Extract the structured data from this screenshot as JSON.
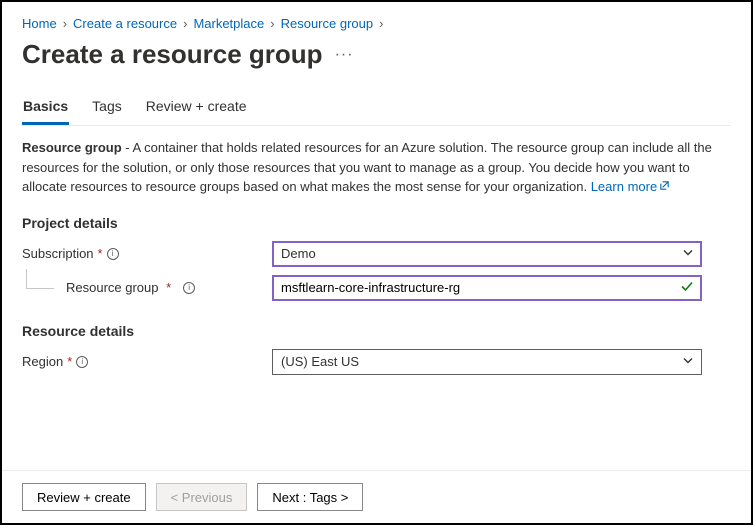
{
  "breadcrumb": {
    "items": [
      "Home",
      "Create a resource",
      "Marketplace",
      "Resource group"
    ]
  },
  "page_title": "Create a resource group",
  "tabs": {
    "items": [
      {
        "label": "Basics",
        "active": true
      },
      {
        "label": "Tags",
        "active": false
      },
      {
        "label": "Review + create",
        "active": false
      }
    ]
  },
  "description": {
    "bold_lead": "Resource group",
    "text": " - A container that holds related resources for an Azure solution. The resource group can include all the resources for the solution, or only those resources that you want to manage as a group. You decide how you want to allocate resources to resource groups based on what makes the most sense for your organization. ",
    "learn_more": "Learn more"
  },
  "sections": {
    "project": {
      "title": "Project details",
      "subscription": {
        "label": "Subscription",
        "value": "Demo"
      },
      "resource_group": {
        "label": "Resource group",
        "value": "msftlearn-core-infrastructure-rg"
      }
    },
    "resource": {
      "title": "Resource details",
      "region": {
        "label": "Region",
        "value": "(US) East US"
      }
    }
  },
  "footer": {
    "review": "Review + create",
    "previous": "< Previous",
    "next": "Next : Tags >"
  }
}
